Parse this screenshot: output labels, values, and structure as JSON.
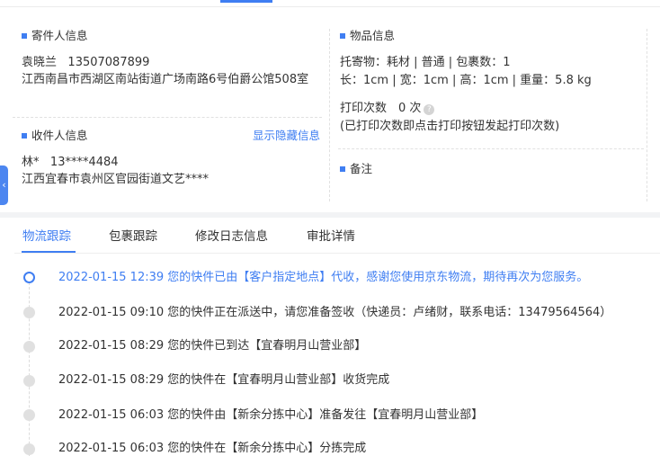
{
  "sender": {
    "title": "寄件人信息",
    "name": "袁晓兰",
    "phone": "13507087899",
    "address": "江西南昌市西湖区南站街道广场南路6号伯爵公馆508室"
  },
  "receiver": {
    "title": "收件人信息",
    "toggle_link": "显示隐藏信息",
    "name": "林*",
    "phone": "13****4484",
    "address": "江西宜春市袁州区官园街道文艺****"
  },
  "goods": {
    "title": "物品信息",
    "line1": "托寄物：耗材 | 普通 | 包裹数：1",
    "line2": "长：1cm | 宽：1cm | 高：1cm | 重量：5.8 kg",
    "print_count": "打印次数　0 次",
    "print_note": "(已打印次数即点击打印按钮发起打印次数)"
  },
  "remark": {
    "title": "备注"
  },
  "tabs": [
    {
      "label": "物流跟踪"
    },
    {
      "label": "包裹跟踪"
    },
    {
      "label": "修改日志信息"
    },
    {
      "label": "审批详情"
    }
  ],
  "timeline": [
    {
      "text": "2022-01-15 12:39 您的快件已由【客户指定地点】代收，感谢您使用京东物流，期待再次为您服务。"
    },
    {
      "text": "2022-01-15 09:10 您的快件正在派送中，请您准备签收（快递员：卢绪财，联系电话：13479564564）"
    },
    {
      "text": "2022-01-15 08:29 您的快件已到达【宜春明月山营业部】"
    },
    {
      "text": "2022-01-15 08:29 您的快件在【宜春明月山营业部】收货完成"
    },
    {
      "text": "2022-01-15 06:03 您的快件由【新余分拣中心】准备发往【宜春明月山营业部】"
    },
    {
      "text": "2022-01-15 06:03 您的快件在【新余分拣中心】分拣完成"
    }
  ],
  "colors": {
    "accent": "#3f7ef2",
    "dot_inactive": "#e0e0e0",
    "band": "#f2f3f5"
  },
  "icons": {
    "side_tab": "chevron-left-icon",
    "help": "question-circle-icon"
  }
}
